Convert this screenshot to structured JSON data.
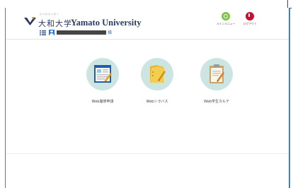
{
  "header": {
    "logo_ruby": "だいわだいがく",
    "logo_jp": "大和大学",
    "logo_en": "Yamato University",
    "main_menu_label": "メインメニュー",
    "logout_label": "ログアウト"
  },
  "user": {
    "name": "██████████",
    "suffix": "様"
  },
  "menu": {
    "items": [
      {
        "label": "Web履修申請",
        "icon": "registration-icon"
      },
      {
        "label": "Webシラバス",
        "icon": "syllabus-folder-icon"
      },
      {
        "label": "Web学生カルテ",
        "icon": "student-record-icon"
      }
    ]
  },
  "colors": {
    "brand_navy": "#2b3a63",
    "frame_blue": "#3a80c8",
    "icon_disk": "#cde5e2",
    "main_menu_green": "#7dc24a",
    "logout_red": "#c8102e"
  }
}
